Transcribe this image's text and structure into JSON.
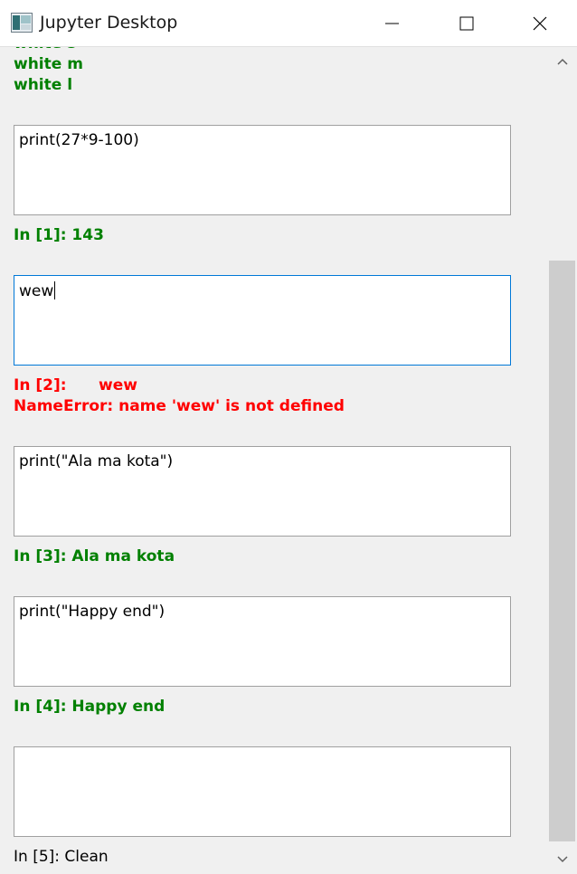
{
  "window": {
    "title": "Jupyter Desktop"
  },
  "top_output": {
    "lines": [
      "white s",
      "white m",
      "white l"
    ]
  },
  "cells": [
    {
      "input": "print(27*9-100)",
      "output_prompt": "In [1]: 143",
      "status": "ok"
    },
    {
      "input": "wew",
      "output_prompt": "In [2]:",
      "output_code": "wew",
      "error": "NameError: name 'wew' is not defined",
      "status": "error"
    },
    {
      "input": "print(\"Ala ma kota\")",
      "output_prompt": "In [3]: Ala ma kota",
      "status": "ok"
    },
    {
      "input": "print(\"Happy end\")",
      "output_prompt": "In [4]: Happy end",
      "status": "ok"
    },
    {
      "input": "",
      "output_prompt": "In [5]: Clean",
      "status": "pending"
    }
  ],
  "colors": {
    "ok": "#008000",
    "error": "#ff0000",
    "focus_border": "#0078d7"
  },
  "icons": {
    "app": "jupyter-desktop-icon",
    "minimize": "minimize-icon",
    "maximize": "maximize-icon",
    "close": "close-icon",
    "scroll_up": "chevron-up-icon",
    "scroll_down": "chevron-down-icon"
  }
}
